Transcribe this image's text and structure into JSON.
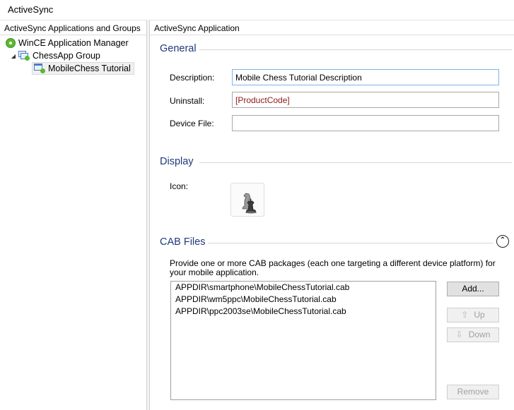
{
  "window": {
    "title": "ActiveSync"
  },
  "left_pane": {
    "header": "ActiveSync Applications and Groups",
    "tree": [
      {
        "label": "WinCE Application Manager",
        "icon": "application-manager-icon"
      },
      {
        "label": "ChessApp Group",
        "icon": "group-icon",
        "expander": "◢"
      },
      {
        "label": "MobileChess Tutorial",
        "icon": "application-icon"
      }
    ]
  },
  "right_pane": {
    "header": "ActiveSync Application",
    "general": {
      "title": "General",
      "description_label": "Description:",
      "description_value": "Mobile Chess Tutorial Description",
      "uninstall_label": "Uninstall:",
      "uninstall_value": "[ProductCode]",
      "device_file_label": "Device File:",
      "device_file_value": ""
    },
    "display": {
      "title": "Display",
      "icon_label": "Icon:",
      "icon": "chess-pieces-icon"
    },
    "cab_files": {
      "title": "CAB Files",
      "collapse_glyph": "⌃",
      "description": "Provide one or more CAB packages (each one targeting a different device platform) for your mobile application.",
      "files": [
        "APPDIR\\smartphone\\MobileChessTutorial.cab",
        "APPDIR\\wm5ppc\\MobileChessTutorial.cab",
        "APPDIR\\ppc2003se\\MobileChessTutorial.cab"
      ],
      "add_label": "Add...",
      "up_label": "Up",
      "down_label": "Down",
      "remove_label": "Remove"
    }
  }
}
